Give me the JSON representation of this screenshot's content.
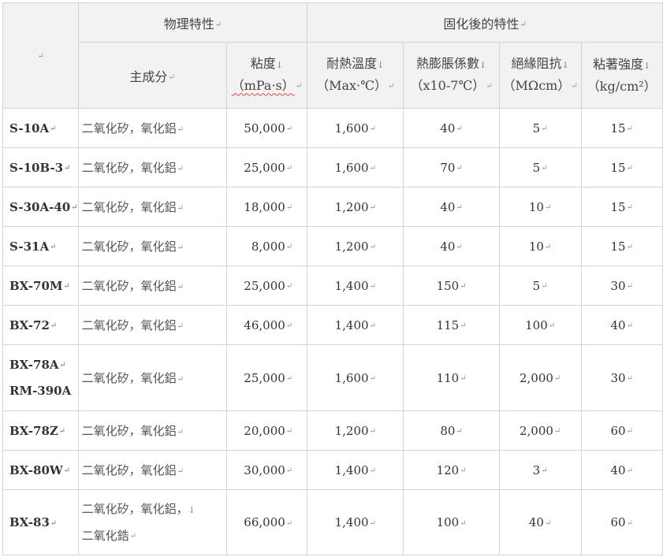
{
  "mark": "↵",
  "arrow": "↓",
  "header": {
    "group_physical": "物理特性",
    "group_cured": "固化後的特性",
    "main_component": "主成分",
    "viscosity_label": "粘度",
    "viscosity_unit": "（mPa·s）",
    "heat_label": "耐熱溫度",
    "heat_unit": "（Max·℃）",
    "expansion_label": "熱膨脹係數",
    "expansion_unit": "（x10-7℃）",
    "insulation_label": "絕緣阻抗",
    "insulation_unit": "（MΩcm）",
    "adhesion_label": "粘著強度",
    "adhesion_unit": "（kg/cm²）"
  },
  "rows": [
    {
      "code": "S-10A",
      "code2": "",
      "component": "二氧化矽，氧化鋁",
      "component2": "",
      "viscosity": "50,000",
      "heat": "1,600",
      "expansion": "40",
      "insulation": "5",
      "adhesion": "15"
    },
    {
      "code": "S-10B-3",
      "code2": "",
      "component": "二氧化矽，氧化鋁",
      "component2": "",
      "viscosity": "25,000",
      "heat": "1,600",
      "expansion": "70",
      "insulation": "5",
      "adhesion": "15"
    },
    {
      "code": "S-30A-40",
      "code2": "",
      "component": "二氧化矽，氧化鋁",
      "component2": "",
      "viscosity": "18,000",
      "heat": "1,200",
      "expansion": "40",
      "insulation": "10",
      "adhesion": "15"
    },
    {
      "code": "S-31A",
      "code2": "",
      "component": "二氧化矽，氧化鋁",
      "component2": "",
      "viscosity": "8,000",
      "heat": "1,200",
      "expansion": "40",
      "insulation": "10",
      "adhesion": "15"
    },
    {
      "code": "BX-70M",
      "code2": "",
      "component": "二氧化矽，氧化鋁",
      "component2": "",
      "viscosity": "25,000",
      "heat": "1,400",
      "expansion": "150",
      "insulation": "5",
      "adhesion": "30"
    },
    {
      "code": "BX-72",
      "code2": "",
      "component": "二氧化矽，氧化鋁",
      "component2": "",
      "viscosity": "46,000",
      "heat": "1,400",
      "expansion": "115",
      "insulation": "100",
      "adhesion": "40"
    },
    {
      "code": "BX-78A",
      "code2": "RM-390A",
      "component": "二氧化矽，氧化鋁",
      "component2": "",
      "viscosity": "25,000",
      "heat": "1,600",
      "expansion": "110",
      "insulation": "2,000",
      "adhesion": "30"
    },
    {
      "code": "BX-78Z",
      "code2": "",
      "component": "二氧化矽，氧化鋁",
      "component2": "",
      "viscosity": "20,000",
      "heat": "1,200",
      "expansion": "80",
      "insulation": "2,000",
      "adhesion": "60"
    },
    {
      "code": "BX-80W",
      "code2": "",
      "component": "二氧化矽，氧化鋁",
      "component2": "",
      "viscosity": "30,000",
      "heat": "1,400",
      "expansion": "120",
      "insulation": "3",
      "adhesion": "40"
    },
    {
      "code": "BX-83",
      "code2": "",
      "component": "二氧化矽，氧化鋁，",
      "component2": "二氧化鋯",
      "viscosity": "66,000",
      "heat": "1,400",
      "expansion": "100",
      "insulation": "40",
      "adhesion": "60"
    }
  ]
}
